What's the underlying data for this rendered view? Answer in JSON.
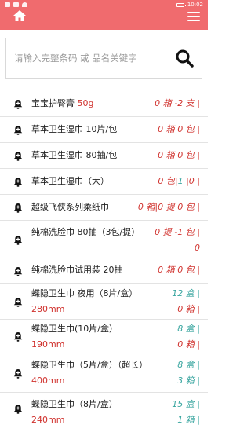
{
  "status_bar": {
    "time": "10:02"
  },
  "header": {
    "home_icon": "home-icon",
    "menu_icon": "hamburger-menu-icon",
    "color": "#f06b6e"
  },
  "search": {
    "placeholder": "请输入完整条码 或 品名关键字",
    "value": ""
  },
  "colors": {
    "red": "#d0312d",
    "teal": "#3aa6a0"
  },
  "items": [
    {
      "name": "宝宝护臀膏 ",
      "spec": "50g",
      "stock": [
        {
          "text": "0 箱",
          "c": "red"
        },
        {
          "text": "|",
          "c": "sep"
        },
        {
          "text": "-2 支",
          "c": "red"
        },
        {
          "text": " |",
          "c": "sep"
        }
      ]
    },
    {
      "name": "草本卫生湿巾 10片/包",
      "spec": "",
      "stock": [
        {
          "text": "0 箱",
          "c": "red"
        },
        {
          "text": "|",
          "c": "sep"
        },
        {
          "text": "0 包",
          "c": "red"
        },
        {
          "text": " |",
          "c": "sep"
        }
      ]
    },
    {
      "name": "草本卫生湿巾 80抽/包",
      "spec": "",
      "stock": [
        {
          "text": "0 箱",
          "c": "red"
        },
        {
          "text": "|",
          "c": "sep"
        },
        {
          "text": "0 包",
          "c": "red"
        },
        {
          "text": " |",
          "c": "sep"
        }
      ]
    },
    {
      "name": "草本卫生湿巾（大）",
      "spec": "",
      "stock": [
        {
          "text": "0 包",
          "c": "red"
        },
        {
          "text": "|",
          "c": "sep"
        },
        {
          "text": "1",
          "c": "teal"
        },
        {
          "text": " |",
          "c": "sep"
        },
        {
          "text": "0",
          "c": "red"
        },
        {
          "text": " |",
          "c": "sep"
        }
      ]
    },
    {
      "name": "超级飞侠系列柔纸巾",
      "spec": "",
      "stock": [
        {
          "text": "0 箱",
          "c": "red"
        },
        {
          "text": "|",
          "c": "sep"
        },
        {
          "text": "0 提",
          "c": "red"
        },
        {
          "text": "|",
          "c": "sep"
        },
        {
          "text": "0 包",
          "c": "red"
        },
        {
          "text": " |",
          "c": "sep"
        }
      ]
    },
    {
      "name": "纯棉洗脸巾 80抽（3包/提）",
      "spec": "",
      "stock": [
        {
          "text": "0 提",
          "c": "red"
        },
        {
          "text": "|",
          "c": "sep"
        },
        {
          "text": "-1 包",
          "c": "red"
        },
        {
          "text": " |",
          "c": "sep"
        },
        {
          "text": "\n0",
          "c": "red"
        }
      ]
    },
    {
      "name": "纯棉洗脸巾试用装 20抽",
      "spec": "",
      "stock": [
        {
          "text": "0 箱",
          "c": "red"
        },
        {
          "text": "|",
          "c": "sep"
        },
        {
          "text": "0 包",
          "c": "red"
        },
        {
          "text": " |",
          "c": "sep"
        }
      ]
    },
    {
      "name": "蝶隐卫生巾 夜用（8片/盒）",
      "spec": "280mm",
      "stock": [
        {
          "text": "12 盒",
          "c": "teal"
        },
        {
          "text": " |",
          "c": "sep-teal"
        },
        {
          "text": "\n0 箱",
          "c": "red"
        },
        {
          "text": " |",
          "c": "sep"
        }
      ]
    },
    {
      "name": "蝶隐卫生巾(10片/盒）",
      "spec": "190mm",
      "stock": [
        {
          "text": "8 盒",
          "c": "teal"
        },
        {
          "text": " |",
          "c": "sep-teal"
        },
        {
          "text": "\n0 箱",
          "c": "red"
        },
        {
          "text": " |",
          "c": "sep"
        }
      ]
    },
    {
      "name": "蝶隐卫生巾（5片/盒）（超长）",
      "spec": "400mm",
      "stock": [
        {
          "text": "8 盒",
          "c": "teal"
        },
        {
          "text": " |",
          "c": "sep-teal"
        },
        {
          "text": "\n3 箱",
          "c": "teal"
        },
        {
          "text": " |",
          "c": "sep-teal"
        }
      ]
    },
    {
      "name": "蝶隐卫生巾（8片/盒）",
      "spec": "240mm",
      "stock": [
        {
          "text": "15 盒",
          "c": "teal"
        },
        {
          "text": " |",
          "c": "sep-teal"
        },
        {
          "text": "\n1 箱",
          "c": "teal"
        },
        {
          "text": " |",
          "c": "sep-teal"
        }
      ]
    }
  ]
}
